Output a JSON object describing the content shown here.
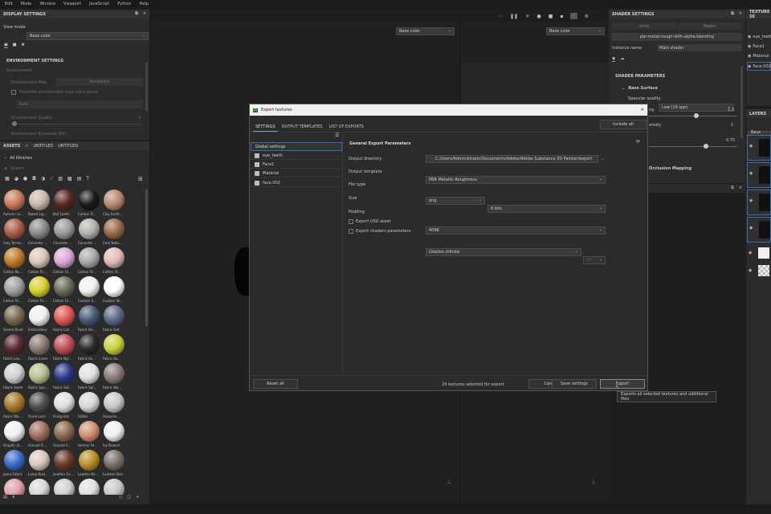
{
  "menu": [
    "Edit",
    "Mode",
    "Window",
    "Viewport",
    "JavaScript",
    "Python",
    "Help"
  ],
  "display_settings": {
    "title": "DISPLAY SETTINGS",
    "view_mode_label": "View mode",
    "view_mode_value": "Base color",
    "env_section": "ENVIRONMENT SETTINGS",
    "environment": "Environment",
    "environment_map": "Environment Map",
    "env_map_value": "Panorama",
    "override_label": "Override environment map color space",
    "color_space": "Auto",
    "env_quality": "Environment Quality",
    "env_quality_value": "4",
    "env_exposure": "Environment Exposure (EV)"
  },
  "assets": {
    "tabs": [
      "ASSETS",
      "UNTITLED",
      "UNTITLED"
    ],
    "all_libraries": "All libraries",
    "search_placeholder": "Search",
    "items": [
      {
        "label": "Autumn Le...",
        "color": "#c97a5a"
      },
      {
        "label": "Baked Lig...",
        "color": "#c9b8a8"
      },
      {
        "label": "Bull Leath...",
        "color": "#5a2a22"
      },
      {
        "label": "Carbon Fi...",
        "color": "#1a1a1a"
      },
      {
        "label": "Clay Earth...",
        "color": "#b88a72"
      },
      {
        "label": "Clay Terras...",
        "color": "#a85a45"
      },
      {
        "label": "Concrete ...",
        "color": "#8a8a8a"
      },
      {
        "label": "Concrete ...",
        "color": "#9a9a98"
      },
      {
        "label": "Concrete ...",
        "color": "#b5b3ae"
      },
      {
        "label": "Cork Natu...",
        "color": "#9a6a45"
      },
      {
        "label": "Cotton Ro...",
        "color": "#c07a2a"
      },
      {
        "label": "Cotton Tri...",
        "color": "#d9c8b8"
      },
      {
        "label": "Cotton Tri...",
        "color": "#d9a8d8"
      },
      {
        "label": "Cotton Tri...",
        "color": "#a8a8a8"
      },
      {
        "label": "Cotton Tri...",
        "color": "#e3b8b8"
      },
      {
        "label": "Cotton Tri...",
        "color": "#a0a0a0"
      },
      {
        "label": "Cotton Tri...",
        "color": "#d8d030"
      },
      {
        "label": "Cotton Tri...",
        "color": "#6a6a5a"
      },
      {
        "label": "Custom S...",
        "color": "#f0f0f0"
      },
      {
        "label": "Custom Sk...",
        "color": "#ffffff"
      },
      {
        "label": "Denim Rivet",
        "color": "#7a6a55"
      },
      {
        "label": "Embroidery",
        "color": "#f0f0f0"
      },
      {
        "label": "Fabric Cot...",
        "color": "#e05858"
      },
      {
        "label": "Fabric De...",
        "color": "#4a5a78"
      },
      {
        "label": "Fabric Felt",
        "color": "#5a6a8a"
      },
      {
        "label": "Fabric Lea...",
        "color": "#5a2a30"
      },
      {
        "label": "Fabric Linen",
        "color": "#8a7a72"
      },
      {
        "label": "Fabric Nyl...",
        "color": "#c0505a"
      },
      {
        "label": "Fabric Ro...",
        "color": "#2a2a2a"
      },
      {
        "label": "Fabric Ro...",
        "color": "#c8d040"
      },
      {
        "label": "Fabric Seam",
        "color": "#d0d0d0"
      },
      {
        "label": "Fabric Spa...",
        "color": "#b8c090"
      },
      {
        "label": "Fabric Sof...",
        "color": "#2a3a8a"
      },
      {
        "label": "Fabric Spi...",
        "color": "#e0e0e0"
      },
      {
        "label": "Fabric Wo...",
        "color": "#8a7a78"
      },
      {
        "label": "Fabric Wo...",
        "color": "#a87a2a"
      },
      {
        "label": "Floral Lace",
        "color": "#505050"
      },
      {
        "label": "Footprints",
        "color": "#e0e0e0"
      },
      {
        "label": "Glitter",
        "color": "#d8d8d8"
      },
      {
        "label": "Gouache ...",
        "color": "#c8c8c8"
      },
      {
        "label": "Graphic Io...",
        "color": "#f0f0f0"
      },
      {
        "label": "Ground Fl...",
        "color": "#a07060"
      },
      {
        "label": "Ground S...",
        "color": "#8a6a50"
      },
      {
        "label": "Human Fe...",
        "color": "#d09070"
      },
      {
        "label": "Ivy Branch",
        "color": "#f0f0f0"
      },
      {
        "label": "Jeans Fabric",
        "color": "#3a6ac8"
      },
      {
        "label": "Lamp Rust...",
        "color": "#d8c8c0"
      },
      {
        "label": "Leather Gr...",
        "color": "#6a3a2a"
      },
      {
        "label": "Leather Ro...",
        "color": "#b8902a"
      },
      {
        "label": "Leather Skin",
        "color": "#7a7068"
      },
      {
        "label": "",
        "color": "#e0a0a8"
      },
      {
        "label": "",
        "color": "#d8d8d8"
      },
      {
        "label": "",
        "color": "#d0d0d0"
      },
      {
        "label": "",
        "color": "#e0e0e0"
      },
      {
        "label": "",
        "color": "#c8c8c8"
      }
    ]
  },
  "viewport": {
    "left_mode": "Base color",
    "right_mode": "Base color"
  },
  "shader_settings": {
    "title": "SHADER SETTINGS",
    "units": "Units",
    "nodes": "Nodes",
    "shader": "pbr-metal-rough-with-alpha-blending",
    "instance_label": "Instance name",
    "instance_value": "Main shader",
    "params_title": "SHADER PARAMETERS",
    "base_surface": "Base Surface",
    "specular_quality_label": "Specular quality",
    "specular_quality_value": "Low (16 spp)",
    "slider1_label": "ng",
    "slider1_value": "1.3",
    "slider2_label": "ensity",
    "slider2_value": "1",
    "slider3_value": "0.75",
    "occlusion": "Occlusion Mapping"
  },
  "texture_sets": {
    "title": "TEXTURE SE",
    "items": [
      "eye_teeth",
      "Face1",
      "Material",
      "Face.002"
    ],
    "layers_title": "LAYERS",
    "layers_mode": "Base color"
  },
  "dialog": {
    "title": "Export textures",
    "tabs": [
      "SETTINGS",
      "OUTPUT TEMPLATES",
      "LIST OF EXPORTS"
    ],
    "include_all": "Include all",
    "global_settings": "Global settings",
    "tree_items": [
      "eye_teeth",
      "Face1",
      "Material",
      "face.002"
    ],
    "section": "General Export Parameters",
    "output_dir_label": "Output directory",
    "output_dir_value": "C:/Users/Administrator/Documents/Adobe/Adobe Substance 3D Painter/export",
    "output_template_label": "Output template",
    "output_template_value": "PBR Metallic Roughness",
    "file_type_label": "File type",
    "file_type_value": "png",
    "bits_value": "8 bits",
    "size_label": "Size",
    "size_value": "4096",
    "padding_label": "Padding",
    "padding_value": "Dilation infinite",
    "padding_num": "16",
    "usd_label": "Export USD asset",
    "shaders_label": "Export shaders parameters",
    "reset_all": "Reset all",
    "status": "24 textures selected for export",
    "cancel": "Cancel",
    "save_settings": "Save settings",
    "export": "Export",
    "tooltip": "Exports all selected textures and additional files"
  }
}
